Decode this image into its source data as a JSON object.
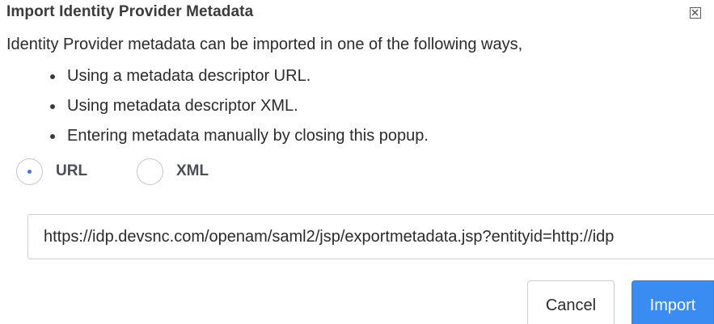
{
  "dialog": {
    "title": "Import Identity Provider Metadata",
    "close_icon": "close-icon",
    "intro": "Identity Provider metadata can be imported in one of the following ways,",
    "ways": [
      "Using a metadata descriptor URL.",
      "Using metadata descriptor XML.",
      "Entering metadata manually by closing this popup."
    ],
    "radio_options": [
      {
        "label": "URL",
        "checked": true
      },
      {
        "label": "XML",
        "checked": false
      }
    ],
    "url_value": "https://idp.devsnc.com/openam/saml2/jsp/exportmetadata.jsp?entityid=http://idp",
    "cancel_label": "Cancel",
    "import_label": "Import"
  },
  "colors": {
    "primary": "#3b8cf2",
    "radio_accent": "#3c7dd9"
  }
}
